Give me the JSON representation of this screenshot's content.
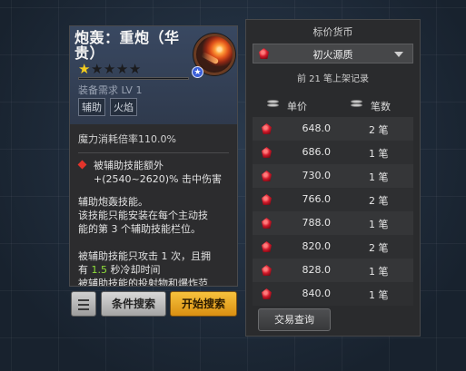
{
  "gem": {
    "name": "炮轰：重炮（华贵）",
    "star_count": 1,
    "star_total": 5,
    "requirement": "装备需求 LV 1",
    "tags": [
      "辅助",
      "火焰"
    ],
    "mana_multiplier": "魔力消耗倍率110.0%",
    "modifier_line1": "被辅助技能额外",
    "modifier_line2": "+(2540~2620)% 击中伤害",
    "desc_line1": "辅助炮轰技能。",
    "desc_line2": "该技能只能安装在每个主动技",
    "desc_line3": "能的第 3 个辅助技能栏位。",
    "desc_line4": "被辅助技能只攻击 1 次，且拥",
    "desc_line5_pre": "有",
    "desc_line5_value": "1.5",
    "desc_line5_post": "秒冷却时间",
    "desc_line6": "被辅助技能的投射物和爆炸范"
  },
  "actions": {
    "condition_search": "条件搜索",
    "start_search": "开始搜索"
  },
  "panel": {
    "title": "标价货币",
    "currency_selected": "初火源质",
    "record_count": "前 21 笔上架记录",
    "col_price": "单价",
    "col_count": "笔数",
    "trade_query": "交易查询"
  },
  "listings": [
    {
      "price": "648.0",
      "count": "2 笔"
    },
    {
      "price": "686.0",
      "count": "1 笔"
    },
    {
      "price": "730.0",
      "count": "1 笔"
    },
    {
      "price": "766.0",
      "count": "2 笔"
    },
    {
      "price": "788.0",
      "count": "1 笔"
    },
    {
      "price": "820.0",
      "count": "2 笔"
    },
    {
      "price": "828.0",
      "count": "1 笔"
    },
    {
      "price": "840.0",
      "count": "1 笔"
    }
  ],
  "icons": {
    "gem": "cannon-fire-gem-icon",
    "currency": "fire-essence-icon",
    "menu": "hamburger-menu-icon",
    "price_header": "coin-stack-icon",
    "count_header": "layer-stack-icon"
  },
  "colors": {
    "star_filled": "#f4cd1e",
    "highlight_value": "#8fdf3a",
    "start_button": "#f0b22c"
  }
}
